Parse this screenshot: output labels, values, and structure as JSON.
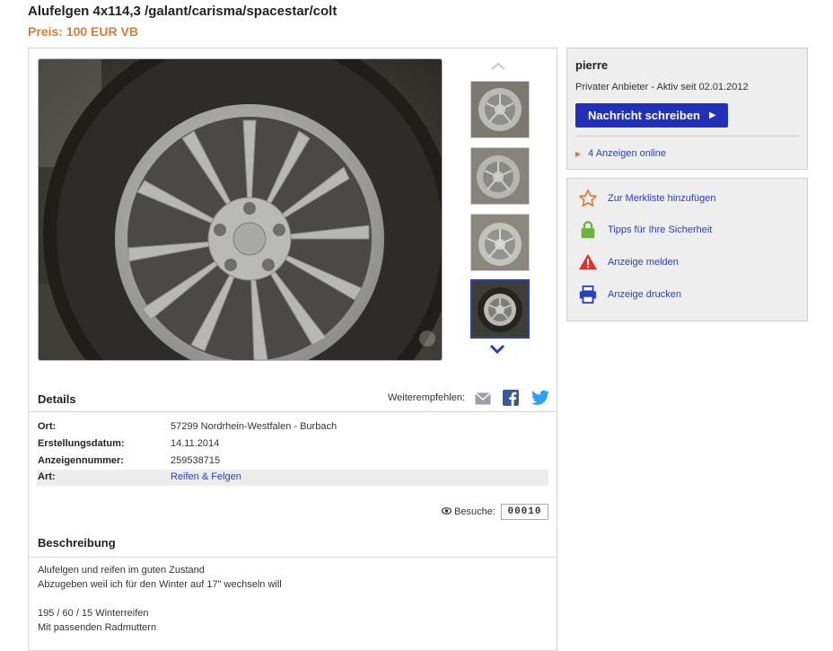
{
  "listing": {
    "title": "Alufelgen 4x114,3 /galant/carisma/spacestar/colt",
    "price": "Preis: 100 EUR VB"
  },
  "gallery": {
    "main_image": "wheel-photo",
    "thumbnails": [
      "wheel-thumb-1",
      "wheel-thumb-2",
      "wheel-thumb-3",
      "wheel-thumb-4"
    ],
    "active_thumbnail": 4
  },
  "details": {
    "heading": "Details",
    "share_label": "Weiterempfehlen:",
    "share_icons": [
      "mail-icon",
      "facebook-icon",
      "twitter-icon"
    ],
    "rows": [
      {
        "label": "Ort:",
        "value": "57299 Nordrhein-Westfalen - Burbach"
      },
      {
        "label": "Erstellungsdatum:",
        "value": "14.11.2014"
      },
      {
        "label": "Anzeigennummer:",
        "value": "259538715"
      },
      {
        "label": "Art:",
        "value": "Reifen & Felgen"
      }
    ],
    "visits_label": "Besuche:",
    "visits_count": "00010"
  },
  "description": {
    "heading": "Beschreibung",
    "lines": [
      "Alufelgen und reifen im guten Zustand",
      "Abzugeben weil ich für den Winter auf 17\" wechseln will",
      "",
      "195 / 60 / 15 Winterreifen",
      "Mit passenden Radmuttern"
    ]
  },
  "seller": {
    "name": "pierre",
    "info": "Privater Anbieter - Aktiv seit 02.01.2012",
    "message_button": "Nachricht schreiben",
    "ads_online": "4 Anzeigen online"
  },
  "actions": [
    {
      "label": "Zur Merkliste hinzufügen",
      "icon": "star-icon"
    },
    {
      "label": "Tipps für Ihre Sicherheit",
      "icon": "lock-icon"
    },
    {
      "label": "Anzeige melden",
      "icon": "warning-icon"
    },
    {
      "label": "Anzeige drucken",
      "icon": "printer-icon"
    }
  ],
  "colors": {
    "accent_blue": "#2130b8",
    "price_orange": "#e07a30",
    "link_blue": "#2a3fb8",
    "panel_gray": "#eeeeee"
  }
}
